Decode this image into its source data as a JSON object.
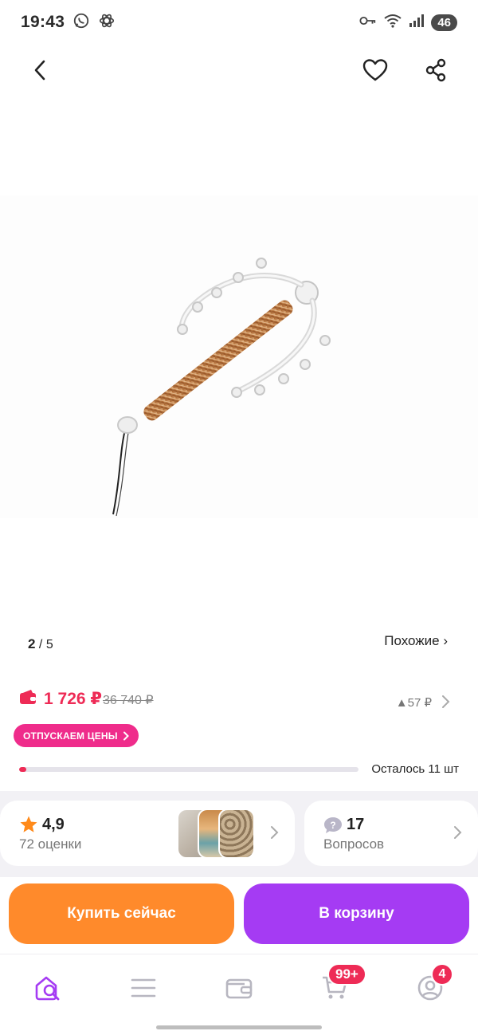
{
  "status_bar": {
    "time": "19:43",
    "battery": "46",
    "icons": [
      "whatsapp-icon",
      "chatgpt-icon",
      "key-icon",
      "wifi-icon",
      "signal-icon"
    ]
  },
  "header": {
    "icons": [
      "back-arrow-icon",
      "heart-icon",
      "share-icon"
    ]
  },
  "gallery": {
    "current": "2",
    "total": "/ 5",
    "similar_label": "Похожие ›"
  },
  "price": {
    "current": "1 726 ₽",
    "old": "36 740 ₽",
    "change": "▲57 ₽",
    "promo_label": "ОТПУСКАЕМ ЦЕНЫ",
    "stock_label": "Осталось 11 шт",
    "stock_progress_percent": 2,
    "accent_color": "#ee2b56",
    "promo_color": "#ef2c8b"
  },
  "reviews": {
    "rating": "4,9",
    "rating_count": "72 оценки",
    "questions_count": "17",
    "questions_label": "Вопросов"
  },
  "actions": {
    "buy_now": "Купить сейчас",
    "add_to_cart": "В корзину",
    "buy_color": "#ff8a2b",
    "cart_color": "#a53bf3"
  },
  "bottom_nav": {
    "cart_badge": "99+",
    "profile_badge": "4",
    "icons": [
      "home-search-icon",
      "catalog-menu-icon",
      "wallet-icon",
      "cart-icon",
      "profile-icon"
    ]
  }
}
